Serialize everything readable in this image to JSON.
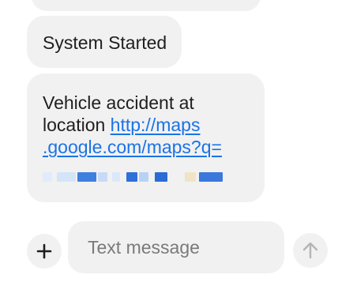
{
  "messages": [
    {
      "text": "System Started"
    },
    {
      "text_line1": "Vehicle accident at",
      "text_line2_prefix": "location ",
      "link_line1": "http://maps",
      "link_line2": ".google.com/maps?q="
    }
  ],
  "compose": {
    "placeholder": "Text message"
  },
  "icons": {
    "add": "plus-icon",
    "send": "arrow-up-icon"
  },
  "colors": {
    "bubble": "#f1f1f1",
    "link": "#1a73e8",
    "text": "#1f1f1f",
    "placeholder": "#7a7a7a"
  }
}
